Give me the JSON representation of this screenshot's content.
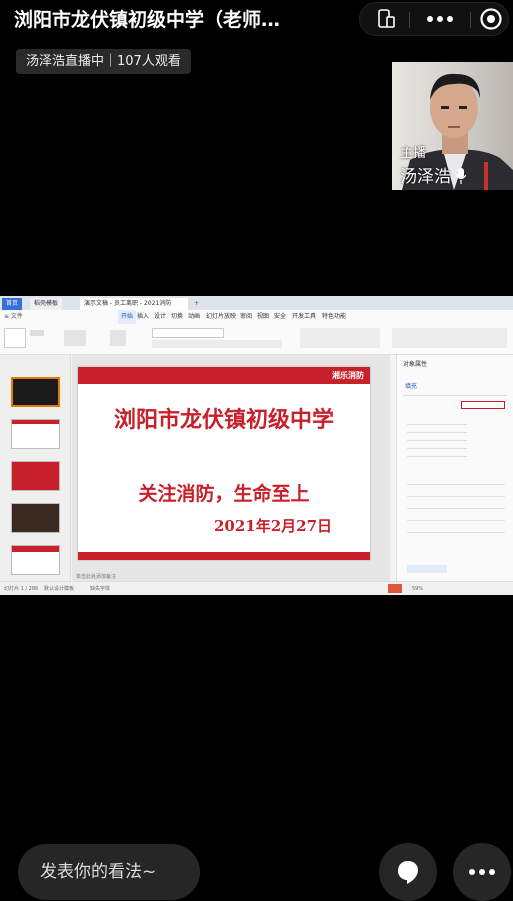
{
  "header": {
    "title": "浏阳市龙伏镇初级中学（老师…"
  },
  "capsule": {
    "icons": [
      "phone-tablet-icon",
      "more-dots-icon",
      "record-target-icon"
    ]
  },
  "live": {
    "host_status": "汤泽浩直播中｜107人观看"
  },
  "pip": {
    "role": "主播",
    "name": "汤泽浩"
  },
  "share": {
    "tabs": [
      "首页",
      "稻壳模板",
      "演示文稿 - 员工离职 - 2021消防"
    ],
    "menu": [
      "开始",
      "插入",
      "设计",
      "切换",
      "动画",
      "幻灯片放映",
      "审阅",
      "视图",
      "安全",
      "开发工具",
      "特色功能"
    ],
    "slide": {
      "header_text": "湘乐消防",
      "title": "浏阳市龙伏镇初级中学",
      "subtitle": "关注消防，生命至上",
      "date": "2021年2月27日"
    },
    "right_pane": {
      "title": "对象属性",
      "section": "填充"
    },
    "status": {
      "page": "幻灯片 1 / 286",
      "theme": "默认设计模板",
      "missing_font": "缺失字体",
      "zoom": "59%"
    },
    "notes_hint": "单击此处添加备注"
  },
  "bottom": {
    "comment_placeholder": "发表你的看法~"
  }
}
